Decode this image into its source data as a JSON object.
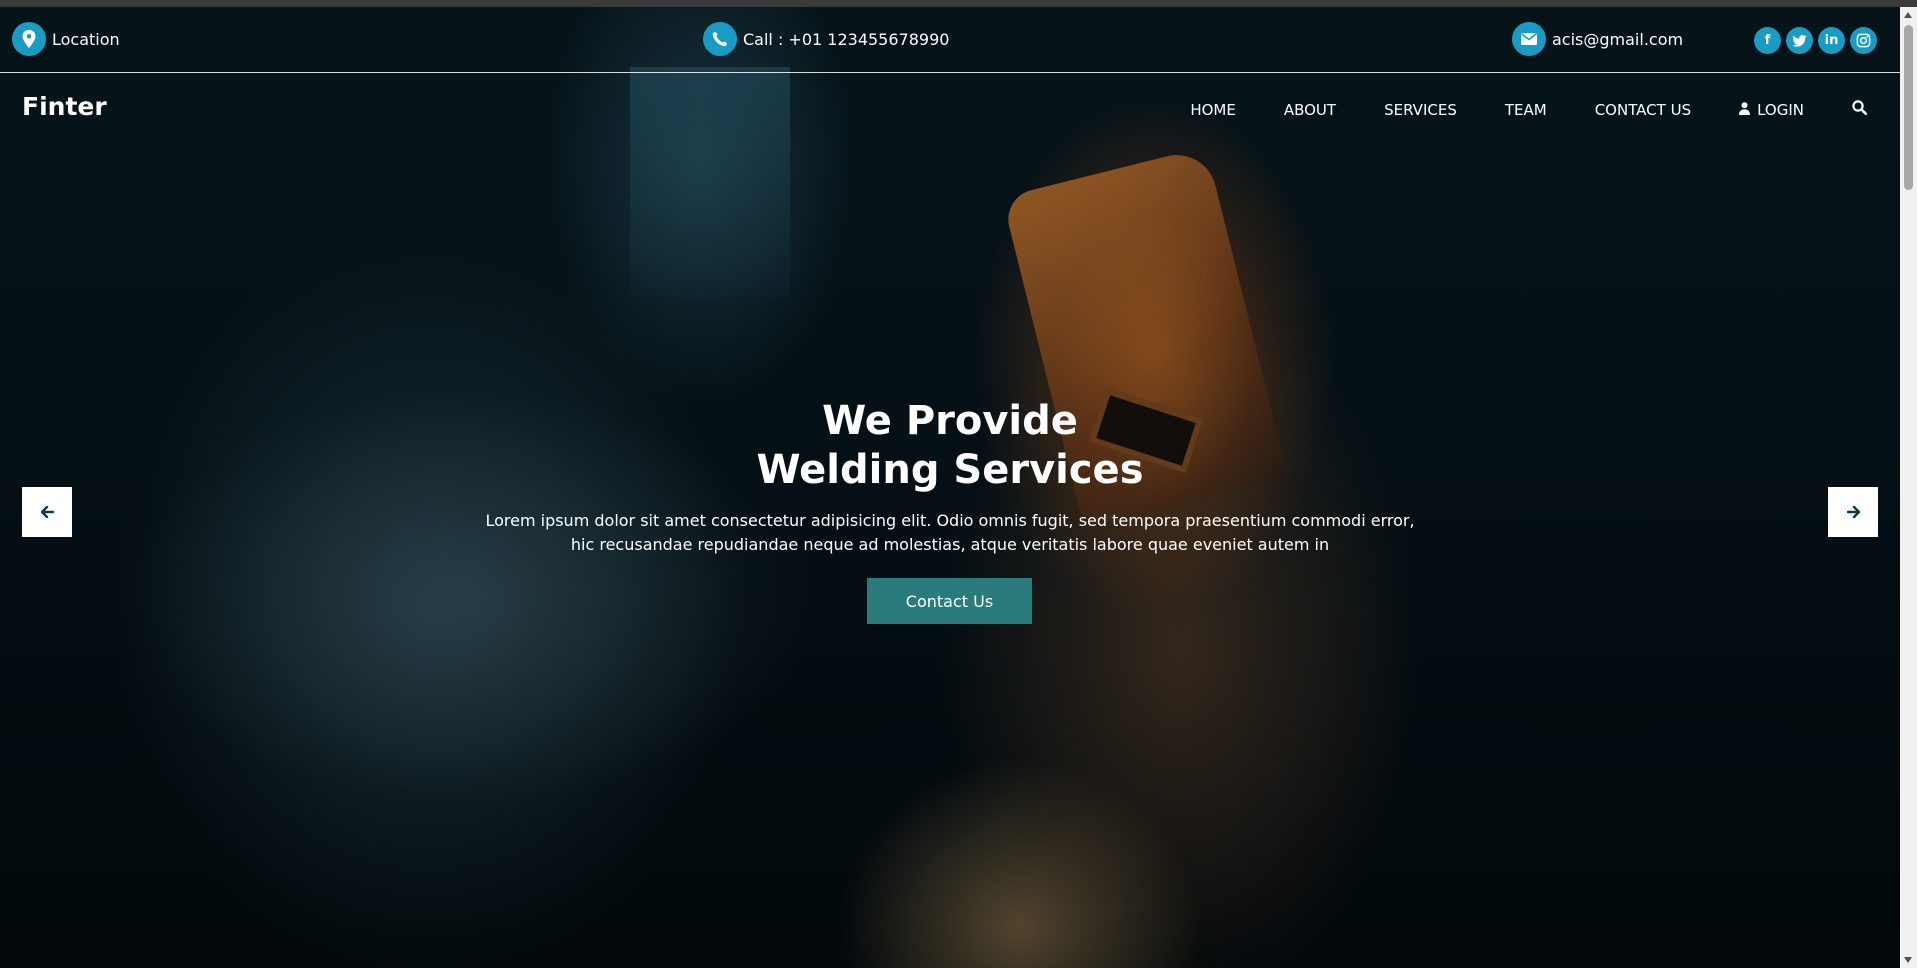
{
  "topbar": {
    "location_label": "Location",
    "phone_label": "Call : +01 123455678990",
    "email_label": "acis@gmail.com",
    "social_icons": [
      "facebook-icon",
      "twitter-icon",
      "linkedin-icon",
      "instagram-icon"
    ]
  },
  "navbar": {
    "brand": "Finter",
    "items": [
      {
        "label": "HOME"
      },
      {
        "label": "ABOUT"
      },
      {
        "label": "SERVICES"
      },
      {
        "label": "TEAM"
      },
      {
        "label": "CONTACT US"
      },
      {
        "label": "LOGIN"
      }
    ],
    "search_icon": "search-icon"
  },
  "hero": {
    "title_line1": "We Provide",
    "title_line2": "Welding Services",
    "text_line1": "Lorem ipsum dolor sit amet consectetur adipisicing elit. Odio omnis fugit, sed tempora praesentium commodi error,",
    "text_line2": "hic recusandae repudiandae neque ad molestias, atque veritatis labore quae eveniet autem in",
    "cta_label": "Contact Us",
    "prev_icon": "arrow-left-icon",
    "next_icon": "arrow-right-icon"
  },
  "colors": {
    "accent": "#1a9bc3",
    "cta": "#2a7b7b",
    "arrow": "#0b3a45"
  }
}
